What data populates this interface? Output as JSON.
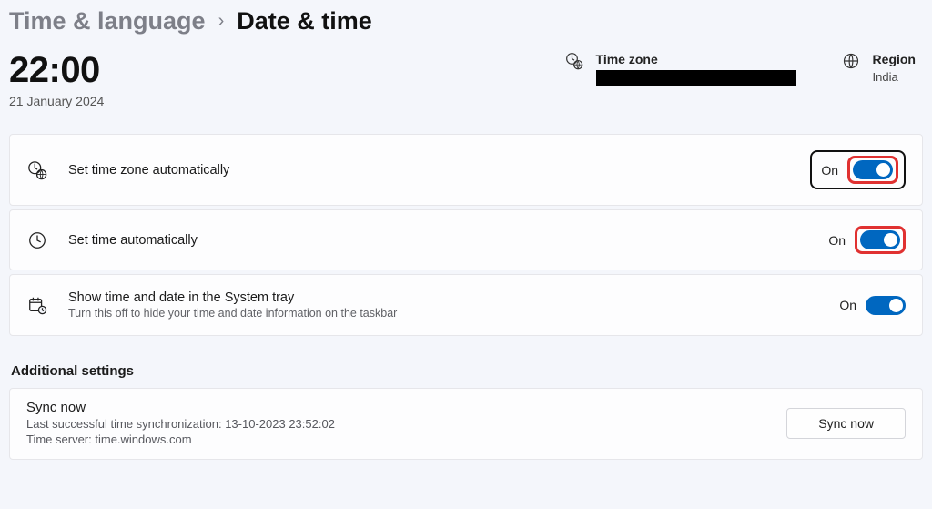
{
  "breadcrumb": {
    "parent": "Time & language",
    "current": "Date & time"
  },
  "clock": {
    "time": "22:00",
    "date": "21 January 2024"
  },
  "timezone": {
    "label": "Time zone",
    "value": ""
  },
  "region": {
    "label": "Region",
    "value": "India"
  },
  "settings": {
    "auto_tz": {
      "title": "Set time zone automatically",
      "state": "On",
      "on": true,
      "highlight": "black_and_red"
    },
    "auto_time": {
      "title": "Set time automatically",
      "state": "On",
      "on": true,
      "highlight": "red"
    },
    "systray": {
      "title": "Show time and date in the System tray",
      "sub": "Turn this off to hide your time and date information on the taskbar",
      "state": "On",
      "on": true,
      "highlight": "none"
    }
  },
  "additional": {
    "heading": "Additional settings",
    "sync": {
      "title": "Sync now",
      "line1": "Last successful time synchronization: 13-10-2023 23:52:02",
      "line2": "Time server: time.windows.com",
      "button": "Sync now"
    }
  }
}
